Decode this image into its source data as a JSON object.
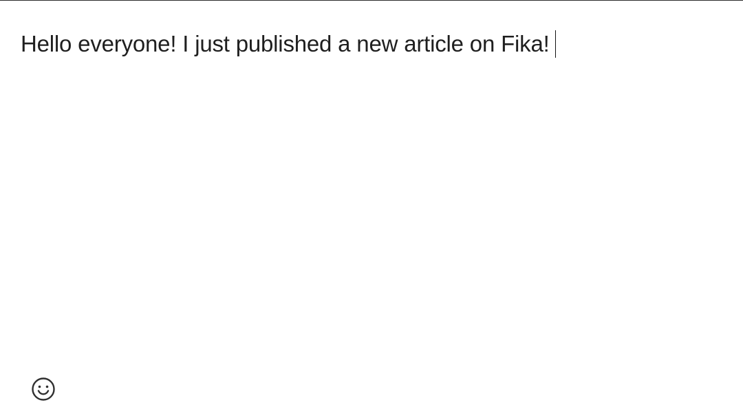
{
  "composer": {
    "text": "Hello everyone! I just published a new article on Fika!"
  },
  "toolbar": {
    "emoji_icon": "smiley-icon"
  },
  "colors": {
    "background": "#ffffff",
    "text": "#1f1f1f",
    "border": "#2b2b2b",
    "icon": "#2f2f2f"
  }
}
